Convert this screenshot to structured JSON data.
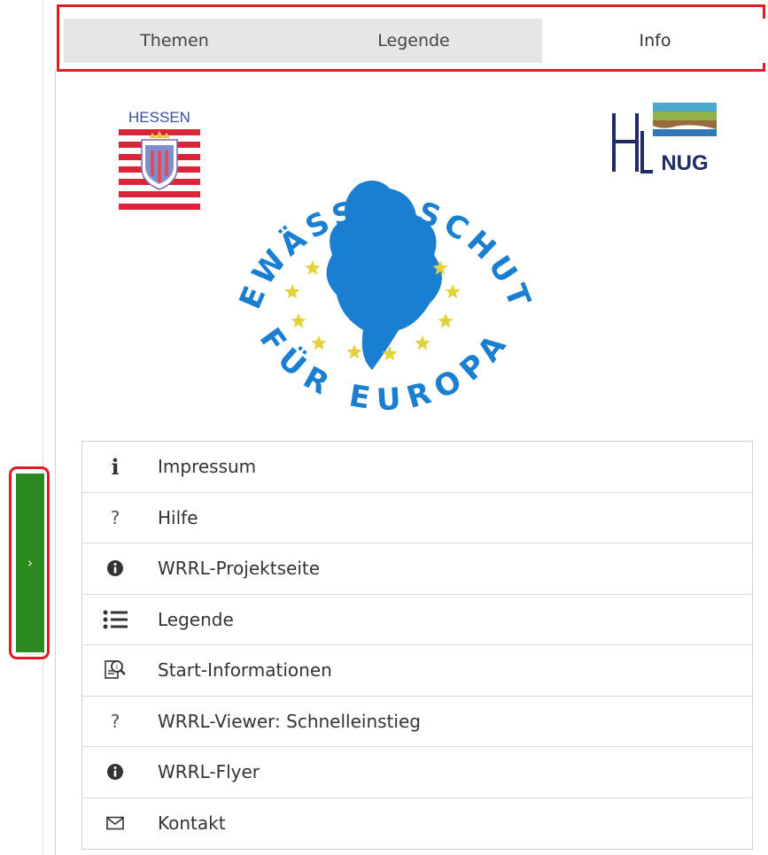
{
  "tabs": [
    {
      "label": "Themen"
    },
    {
      "label": "Legende"
    },
    {
      "label": "Info"
    }
  ],
  "active_tab": "Info",
  "toggle": {
    "glyph": "›"
  },
  "logos": {
    "hessen_text": "HESSEN",
    "hlnug_text": "NUG",
    "gewasser_top": "GEWÄSSERSCHUTZ",
    "gewasser_bottom": "FÜR EUROPA"
  },
  "menu": [
    {
      "label": "Impressum",
      "icon": "info-letter-icon"
    },
    {
      "label": "Hilfe",
      "icon": "question-icon"
    },
    {
      "label": "WRRL-Projektseite",
      "icon": "info-circle-icon"
    },
    {
      "label": "Legende",
      "icon": "list-icon"
    },
    {
      "label": "Start-Informationen",
      "icon": "document-search-icon"
    },
    {
      "label": "WRRL-Viewer: Schnelleinstieg",
      "icon": "question-icon"
    },
    {
      "label": "WRRL-Flyer",
      "icon": "info-circle-icon"
    },
    {
      "label": "Kontakt",
      "icon": "envelope-icon"
    }
  ],
  "colors": {
    "toggle_green": "#2a8a1e",
    "highlight_red": "#e01b24",
    "tab_inactive": "#e6e6e6",
    "logo_blue": "#1b7fd1",
    "star_yellow": "#e3d23a",
    "hessen_red": "#d9243a"
  }
}
